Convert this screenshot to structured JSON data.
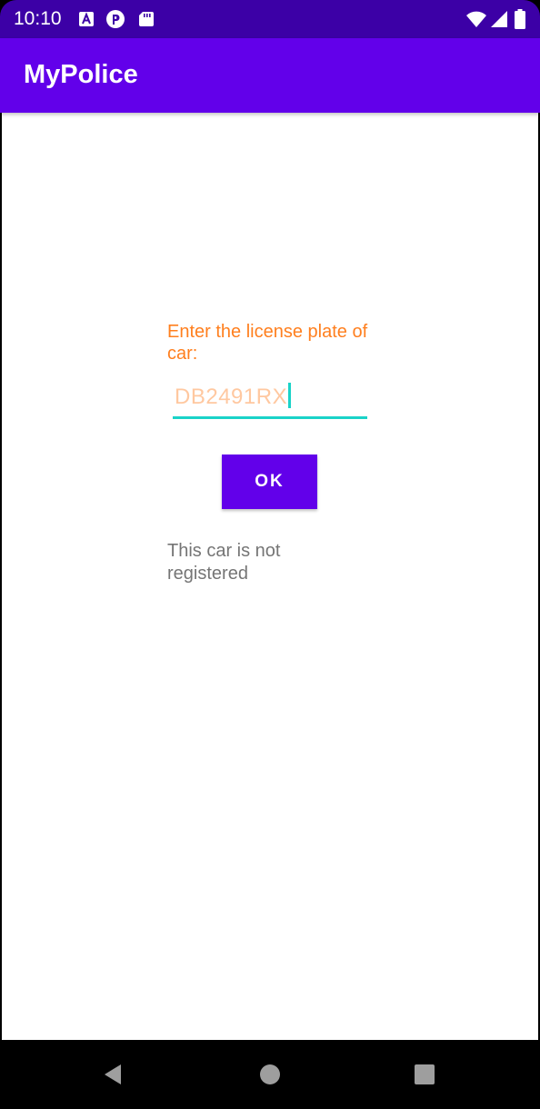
{
  "status_bar": {
    "time": "10:10",
    "left_icons": [
      "text-a-icon",
      "podcast-icon",
      "sd-card-icon"
    ],
    "right_icons": [
      "wifi-icon",
      "signal-icon",
      "battery-icon"
    ]
  },
  "app_bar": {
    "title": "MyPolice"
  },
  "form": {
    "prompt": "Enter the license plate of car:",
    "plate_value": "DB2491RX",
    "ok_label": "OK",
    "result": "This car is not registered"
  },
  "nav_bar": {
    "buttons": [
      "back-icon",
      "home-icon",
      "recents-icon"
    ]
  },
  "colors": {
    "status_bar": "#3c00a6",
    "primary": "#6200ea",
    "prompt_text": "#ff7f1e",
    "input_text": "#ffc8a0",
    "accent": "#1ad3c8",
    "result_text": "#757575"
  }
}
